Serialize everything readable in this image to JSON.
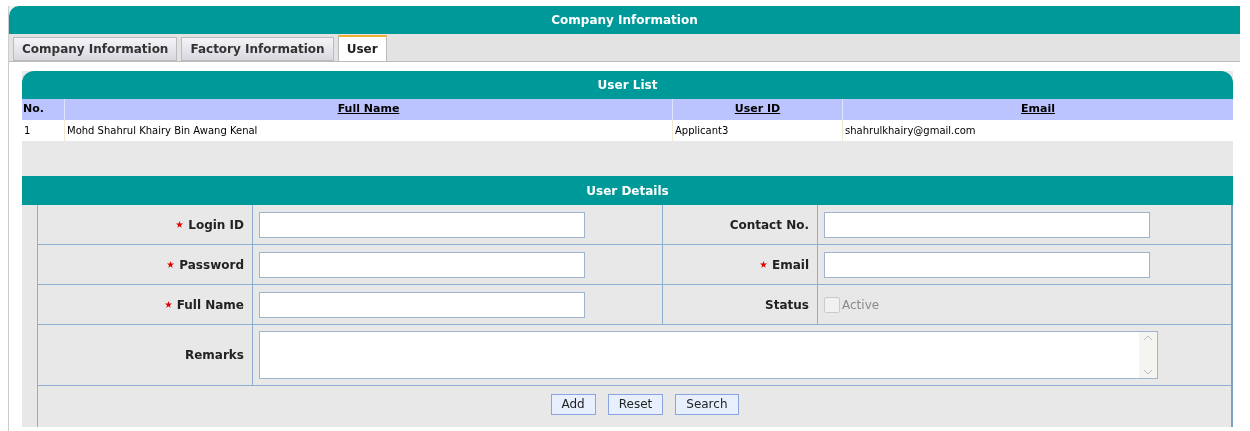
{
  "header": {
    "title": "Company Information"
  },
  "tabs": [
    {
      "label": "Company Information",
      "selected": false
    },
    {
      "label": "Factory Information",
      "selected": false
    },
    {
      "label": "User",
      "selected": true
    }
  ],
  "user_list": {
    "title": "User List",
    "columns": [
      "No.",
      "Full Name",
      "User ID",
      "Email"
    ],
    "rows": [
      [
        "1",
        "Mohd Shahrul Khairy Bin Awang Kenal",
        "Applicant3",
        "shahrulkhairy@gmail.com"
      ]
    ]
  },
  "user_details": {
    "title": "User Details",
    "left_fields": [
      {
        "label": "Login ID",
        "required": true
      },
      {
        "label": "Password",
        "required": true
      },
      {
        "label": "Full Name",
        "required": true
      }
    ],
    "right_fields": [
      {
        "label": "Contact No.",
        "required": false
      },
      {
        "label": "Email",
        "required": true
      }
    ],
    "status": {
      "label": "Status",
      "option": "Active",
      "checked": false,
      "disabled": true
    },
    "remarks": {
      "label": "Remarks"
    },
    "buttons": [
      "Add",
      "Reset",
      "Search"
    ]
  }
}
